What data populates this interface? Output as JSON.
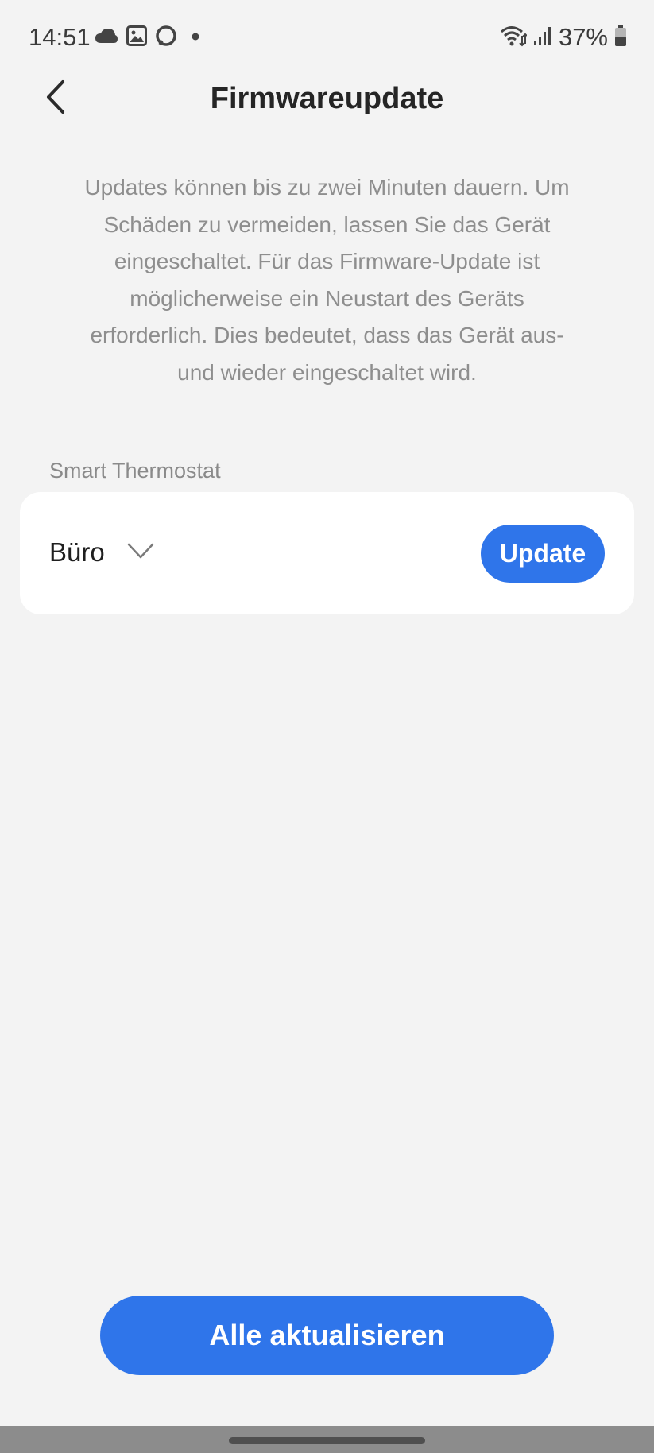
{
  "status_bar": {
    "time": "14:51",
    "battery": "37%",
    "left_icons": [
      "cloud-icon",
      "gallery-icon",
      "alexa-icon",
      "notification-dot-icon"
    ],
    "right_icons": [
      "wifi-icon",
      "signal-icon",
      "battery-icon"
    ]
  },
  "header": {
    "title": "Firmwareupdate",
    "back_icon": "chevron-left-icon"
  },
  "description": "Updates können bis zu zwei Minuten dauern. Um Schäden zu vermeiden, lassen Sie das Gerät eingeschaltet. Für das Firmware-Update ist möglicherweise ein Neustart des Geräts erforderlich. Dies bedeutet, dass das Gerät aus- und wieder eingeschaltet wird.",
  "section": {
    "label": "Smart Thermostat",
    "device": {
      "name": "Büro",
      "update_label": "Update"
    }
  },
  "footer": {
    "update_all_label": "Alle aktualisieren"
  },
  "colors": {
    "accent": "#2f75ea",
    "background": "#f3f3f3",
    "card": "#ffffff",
    "secondary_text": "#8e8e8e"
  }
}
